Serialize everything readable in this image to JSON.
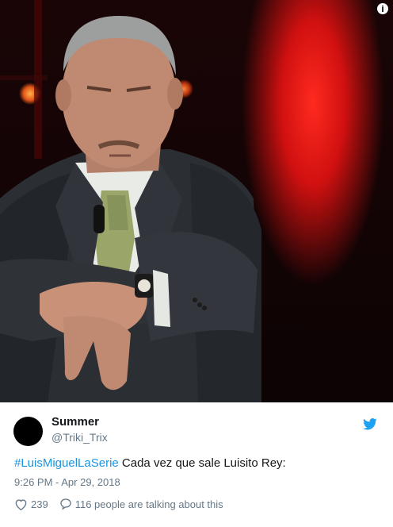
{
  "tweet": {
    "display_name": "Summer",
    "handle": "@Triki_Trix",
    "hashtag": "#LuisMiguelLaSerie",
    "body": " Cada vez que sale Luisito Rey:",
    "timestamp": "9:26 PM - Apr 29, 2018",
    "likes": "239",
    "talking": "116 people are talking about this"
  },
  "icons": {
    "info": "info-icon",
    "bird": "twitter-bird-icon",
    "like": "heart-icon",
    "reply": "speech-bubble-icon"
  },
  "colors": {
    "link": "#1b95e0",
    "muted": "#657786",
    "text": "#14171a"
  }
}
